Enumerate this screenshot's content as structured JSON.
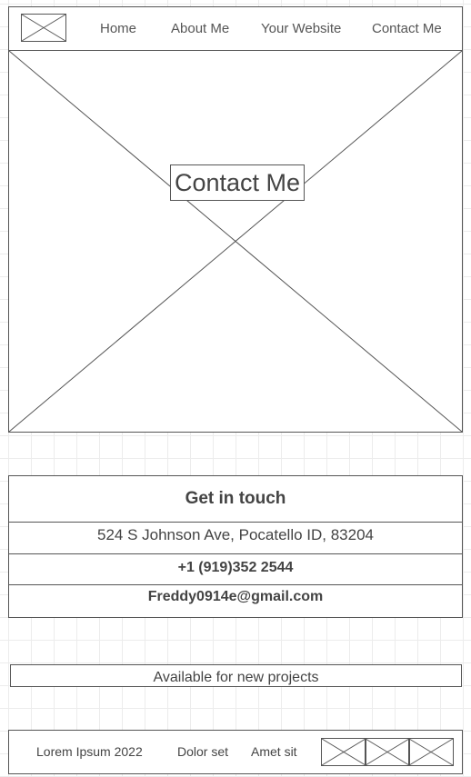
{
  "nav": {
    "logo_icon": "placeholder-image-icon",
    "links": [
      "Home",
      "About Me",
      "Your Website",
      "Contact Me"
    ]
  },
  "hero": {
    "image_icon": "placeholder-image-icon",
    "title": "Contact Me"
  },
  "contact": {
    "heading": "Get in touch",
    "address": "524 S Johnson Ave, Pocatello ID, 83204",
    "phone": "+1 (919)352 2544",
    "email": "Freddy0914e@gmail.com"
  },
  "availability": "Available for new projects",
  "footer": {
    "copyright": "Lorem Ipsum 2022",
    "links": [
      "Dolor set",
      "Amet sit"
    ],
    "social_icons": [
      "placeholder-image-icon",
      "placeholder-image-icon",
      "placeholder-image-icon"
    ]
  },
  "colors": {
    "border": "#555555",
    "text": "#444444",
    "grid": "#ececec"
  }
}
